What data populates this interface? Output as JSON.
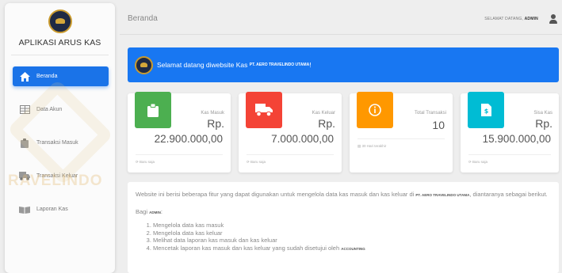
{
  "sidebar": {
    "brand": "APLIKASI ARUS KAS",
    "watermark": "RAVELINDO",
    "items": [
      {
        "label": "Beranda",
        "icon": "home-icon"
      },
      {
        "label": "Data Akun",
        "icon": "table-icon"
      },
      {
        "label": "Transaksi Masuk",
        "icon": "clipboard-icon"
      },
      {
        "label": "Transaksi Keluar",
        "icon": "truck-icon"
      },
      {
        "label": "Laporan Kas",
        "icon": "book-icon"
      }
    ]
  },
  "header": {
    "breadcrumb": "Beranda",
    "welcome_prefix": "SELAMAT DATANG,",
    "user": "ADMIN"
  },
  "banner": {
    "text": "Selamat datang diwebsite Kas",
    "company": "PT. AERO TRAVELINDO UTAMA",
    "suffix": "!"
  },
  "cards": [
    {
      "label": "Kas Masuk",
      "rp": "Rp.",
      "value": "22.900.000,00",
      "footer": "Baru saja",
      "color": "#4caf50",
      "icon": "clipboard-icon"
    },
    {
      "label": "Kas Keluar",
      "rp": "Rp.",
      "value": "7.000.000,00",
      "footer": "Baru saja",
      "color": "#f44336",
      "icon": "truck-icon"
    },
    {
      "label": "Total Transaksi",
      "value": "10",
      "footer": "30 Hari terakhir",
      "color": "#ff9800",
      "icon": "info-icon"
    },
    {
      "label": "Sisa Kas",
      "rp": "Rp.",
      "value": "15.900.000,00",
      "footer": "Baru saja",
      "color": "#00bcd4",
      "icon": "document-icon"
    }
  ],
  "info": {
    "intro": "Website ini berisi beberapa fitur yang dapat digunakan untuk mengelola data kas masuk dan kas keluar di",
    "company": "PT. AERO TRAVELINDO UTAMA",
    "intro_end": ", diantaranya sebagai berikut.",
    "bagi_prefix": "Bagi",
    "bagi_role": "ADMIN",
    "bagi_suffix": ":",
    "list": [
      "Mengelola data kas masuk",
      "Mengelola data kas keluar",
      "Melihat data laporan kas masuk dan kas keluar",
      "Mencetak laporan kas masuk dan kas keluar yang sudah disetujui oleh"
    ],
    "list_last_bold": "ACCOUNTING"
  }
}
